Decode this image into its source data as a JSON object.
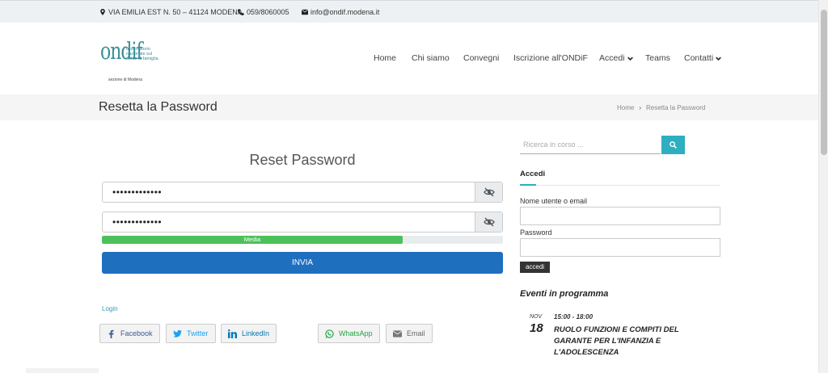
{
  "topbar": {
    "address": "VIA EMILIA EST N. 50 – 41124 MODENA",
    "phone": "059/8060005",
    "email": "info@ondif.modena.it"
  },
  "logo": {
    "mark": "ondif",
    "tagline": "osservatorio nazionale sul diritto di famiglia",
    "section": "sezione di Modena"
  },
  "nav": {
    "items": [
      "Home",
      "Chi siamo",
      "Convegni",
      "Iscrizione all'ONDiF",
      "Accedi",
      "Teams",
      "Contatti"
    ]
  },
  "page": {
    "title": "Resetta la Password",
    "breadcrumb": [
      "Home",
      "Resetta la Password"
    ]
  },
  "form": {
    "heading": "Reset Password",
    "password1": "•••••••••••••",
    "password2": "•••••••••••••",
    "strength_label": "Media",
    "strength": 0.75,
    "submit": "INVIA",
    "login_link": "Login"
  },
  "share": {
    "facebook": "Facebook",
    "twitter": "Twitter",
    "linkedin": "LinkedIn",
    "whatsapp": "WhatsApp",
    "email": "Email"
  },
  "sidebar": {
    "search_placeholder": "Ricerca in corso ...",
    "login_heading": "Accedi",
    "username_label": "Nome utente o email",
    "password_label": "Password",
    "login_button": "accedi",
    "events_heading": "Eventi in programma",
    "event": {
      "month": "NOV",
      "day": "18",
      "time": "15:00 - 18:00",
      "title": "RUOLO FUNZIONI E COMPITI DEL GARANTE PER L'INFANZIA E L'ADOLESCENZA"
    }
  },
  "colors": {
    "accent": "#2eaec1",
    "submit": "#1f6fbf",
    "strength": "#4cc15a"
  }
}
